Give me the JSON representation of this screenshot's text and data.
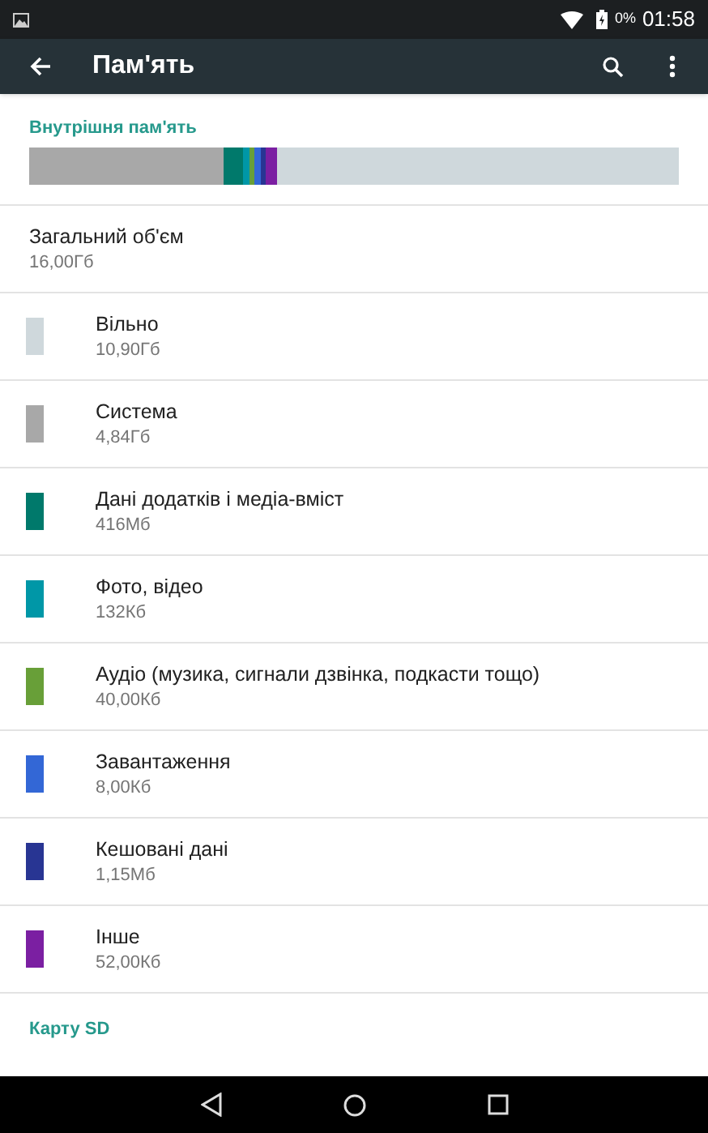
{
  "status_bar": {
    "battery": "0%",
    "time": "01:58"
  },
  "toolbar": {
    "title": "Пам'ять"
  },
  "internal": {
    "header": "Внутрішня пам'ять",
    "total": {
      "label": "Загальний об'єм",
      "value": "16,00Гб"
    },
    "categories": [
      {
        "label": "Вільно",
        "value": "10,90Гб",
        "color": "#cfd8dc"
      },
      {
        "label": "Система",
        "value": "4,84Гб",
        "color": "#a8a8a8"
      },
      {
        "label": "Дані додатків і медіа-вміст",
        "value": "416Мб",
        "color": "#00796b"
      },
      {
        "label": "Фото, відео",
        "value": "132Кб",
        "color": "#0097a7"
      },
      {
        "label": "Аудіо (музика, сигнали дзвінка, подкасти тощо)",
        "value": "40,00Кб",
        "color": "#689f38"
      },
      {
        "label": "Завантаження",
        "value": "8,00Кб",
        "color": "#3367d6"
      },
      {
        "label": "Кешовані дані",
        "value": "1,15Мб",
        "color": "#283593"
      },
      {
        "label": "Інше",
        "value": "52,00Кб",
        "color": "#7b1fa2"
      }
    ]
  },
  "sd_card": {
    "header": "Карту SD"
  }
}
